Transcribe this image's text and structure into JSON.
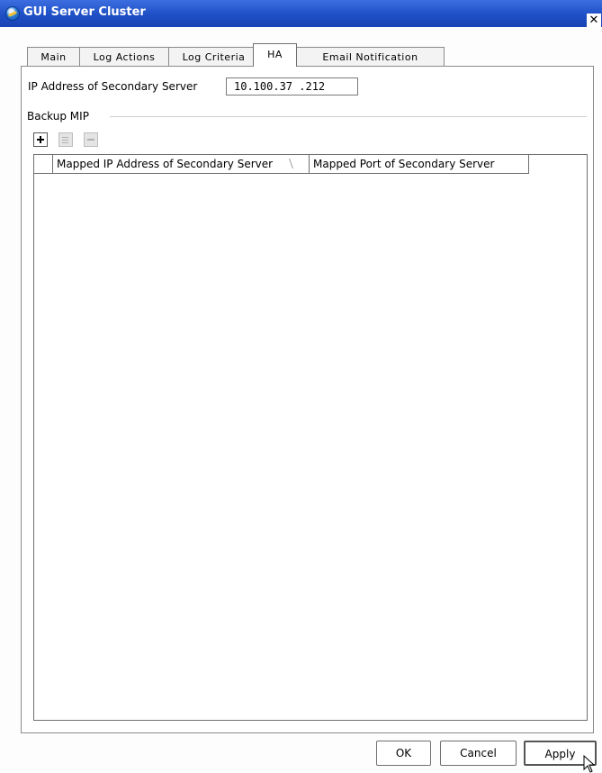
{
  "window": {
    "title": "GUI Server Cluster",
    "close_glyph": "✕"
  },
  "tabs": [
    {
      "label": "Main"
    },
    {
      "label": "Log Actions"
    },
    {
      "label": "Log Criteria"
    },
    {
      "label": "HA"
    },
    {
      "label": "Email Notification"
    }
  ],
  "active_tab": "HA",
  "ha": {
    "ip_label": "IP Address of Secondary Server",
    "ip_value": "10.100.37 .212",
    "group_label": "Backup MIP",
    "table": {
      "columns": [
        {
          "label": "Mapped IP Address of Secondary Server"
        },
        {
          "label": "Mapped Port of Secondary Server"
        }
      ],
      "rows": []
    }
  },
  "buttons": {
    "ok": "OK",
    "cancel": "Cancel",
    "apply": "Apply"
  }
}
